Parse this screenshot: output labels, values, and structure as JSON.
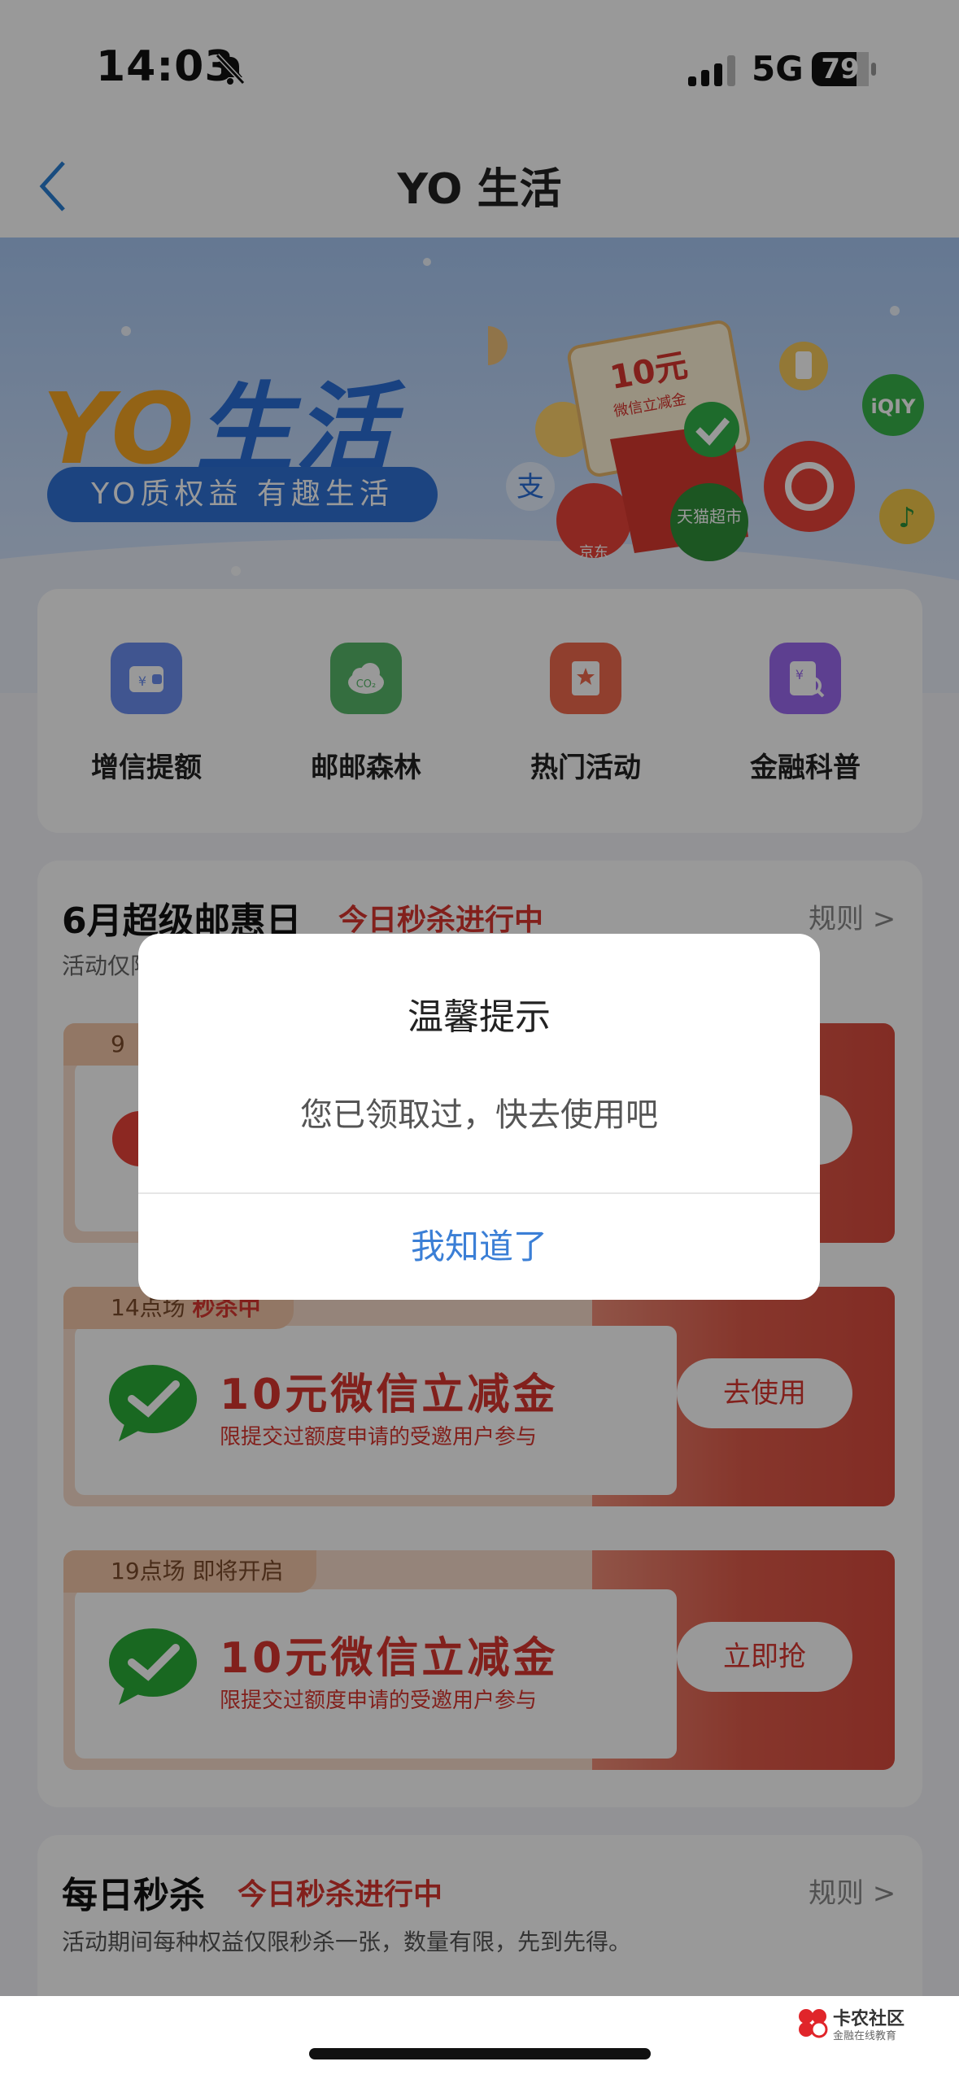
{
  "status_bar": {
    "time": "14:03",
    "network": "5G",
    "battery": "79"
  },
  "nav": {
    "title": "YO 生活"
  },
  "banner": {
    "logo_text_1": "YO",
    "logo_text_2": "生活",
    "slogan": "YO质权益 有趣生活",
    "coupon_amount": "10元",
    "coupon_caption": "微信立减金",
    "shop_label": "天猫超市",
    "jd_label": "京东"
  },
  "quick_menu": [
    {
      "label": "增信提额",
      "icon": "wallet-icon",
      "color": "#6b8ef0"
    },
    {
      "label": "邮邮森林",
      "icon": "co2-cloud-icon",
      "color": "#58b86a"
    },
    {
      "label": "热门活动",
      "icon": "bookmark-icon",
      "color": "#f06a4e"
    },
    {
      "label": "金融科普",
      "icon": "money-search-icon",
      "color": "#9b6af0"
    }
  ],
  "promo": {
    "title": "6月超级邮惠日",
    "live": "今日秒杀进行中",
    "rules": "规则 >",
    "note": "活动仅限",
    "tickets": [
      {
        "tag_time": "9",
        "tag_status": "",
        "name": "",
        "desc": "",
        "button": ""
      },
      {
        "tag_time": "14点场",
        "tag_status": "秒杀中",
        "name": "10元微信立减金",
        "desc": "限提交过额度申请的受邀用户参与",
        "button": "去使用"
      },
      {
        "tag_time": "19点场 即将开启",
        "tag_status": "",
        "name": "10元微信立减金",
        "desc": "限提交过额度申请的受邀用户参与",
        "button": "立即抢"
      }
    ]
  },
  "daily": {
    "title": "每日秒杀",
    "live": "今日秒杀进行中",
    "rules": "规则 >",
    "note": "活动期间每种权益仅限秒杀一张，数量有限，先到先得。"
  },
  "watermark": {
    "title": "卡农社区",
    "subtitle": "金融在线教育"
  },
  "dialog": {
    "title": "温馨提示",
    "message": "您已领取过，快去使用吧",
    "button": "我知道了"
  }
}
